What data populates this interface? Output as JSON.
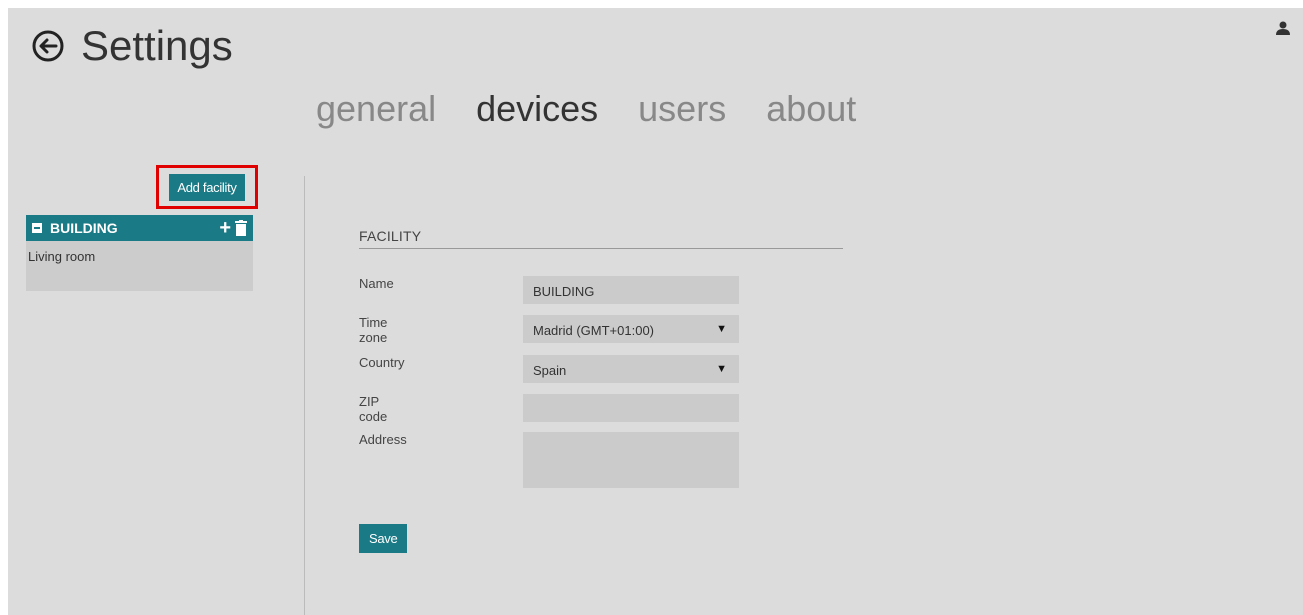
{
  "header": {
    "title": "Settings",
    "back_icon": "back-arrow-circle-icon",
    "user_icon": "user-icon"
  },
  "tabs": [
    {
      "label": "general",
      "active": false
    },
    {
      "label": "devices",
      "active": true
    },
    {
      "label": "users",
      "active": false
    },
    {
      "label": "about",
      "active": false
    }
  ],
  "sidebar": {
    "add_button": "Add facility",
    "facility": {
      "name": "BUILDING",
      "rooms": [
        "Living room"
      ]
    }
  },
  "form": {
    "section_title": "FACILITY",
    "fields": {
      "name": {
        "label": "Name",
        "value": "BUILDING"
      },
      "timezone": {
        "label": "Time zone",
        "value": "Madrid (GMT+01:00)"
      },
      "country": {
        "label": "Country",
        "value": "Spain"
      },
      "zip": {
        "label": "ZIP code",
        "value": ""
      },
      "address": {
        "label": "Address",
        "value": ""
      }
    },
    "save_label": "Save"
  },
  "colors": {
    "accent": "#1a7a86",
    "background": "#dcdcdc",
    "highlight": "#e00000"
  }
}
